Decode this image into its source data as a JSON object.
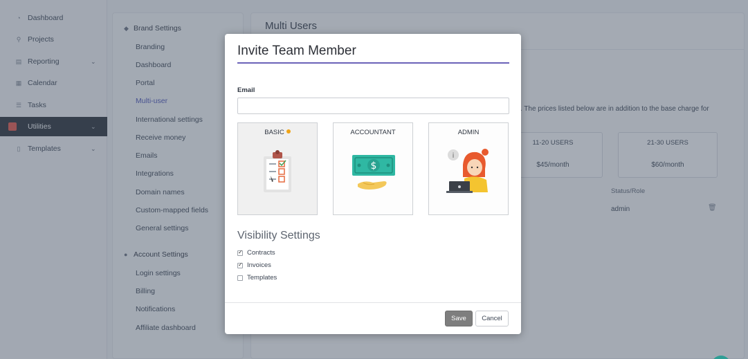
{
  "nav": {
    "items": [
      {
        "label": "Dashboard",
        "icon": "◔"
      },
      {
        "label": "Projects",
        "icon": "⚲"
      },
      {
        "label": "Reporting",
        "icon": "▤",
        "expandable": true
      },
      {
        "label": "Calendar",
        "icon": "▦"
      },
      {
        "label": "Tasks",
        "icon": "☰"
      },
      {
        "label": "Utilities",
        "icon": "■",
        "expandable": true,
        "active": true
      },
      {
        "label": "Templates",
        "icon": "▯",
        "expandable": true
      }
    ]
  },
  "settings": {
    "brand_heading": "Brand Settings",
    "brand_items": [
      "Branding",
      "Dashboard",
      "Portal",
      "Multi-user",
      "International settings",
      "Receive money",
      "Emails",
      "Integrations",
      "Domain names",
      "Custom-mapped fields",
      "General settings"
    ],
    "active_item": "Multi-user",
    "account_heading": "Account Settings",
    "account_items": [
      "Login settings",
      "Billing",
      "Notifications",
      "Affiliate dashboard"
    ]
  },
  "main": {
    "title": "Multi Users",
    "description_fragment": "rd. The prices listed below are in addition to the base charge for",
    "pricing": [
      {
        "title": "11-20 USERS",
        "price": "$45/month"
      },
      {
        "title": "21-30 USERS",
        "price": "$60/month"
      }
    ],
    "table": {
      "column_header": "Status/Role",
      "rows": [
        {
          "role": "admin"
        }
      ]
    }
  },
  "modal": {
    "title": "Invite Team Member",
    "email_label": "Email",
    "email_value": "",
    "email_placeholder": "",
    "roles": [
      {
        "label": "BASIC",
        "icon": "clipboard-checklist",
        "selected": true
      },
      {
        "label": "ACCOUNTANT",
        "icon": "money-hand"
      },
      {
        "label": "ADMIN",
        "icon": "person-laptop"
      }
    ],
    "visibility_title": "Visibility Settings",
    "visibility": [
      {
        "label": "Contracts",
        "checked": true
      },
      {
        "label": "Invoices",
        "checked": true
      },
      {
        "label": "Templates",
        "checked": false
      }
    ],
    "save_label": "Save",
    "cancel_label": "Cancel"
  },
  "colors": {
    "accent": "#6b62b8",
    "active_nav": "#2a2f36",
    "utilities_badge": "#e8574a",
    "selected_dot": "#f0a417",
    "save_button": "#7e7e7e"
  }
}
